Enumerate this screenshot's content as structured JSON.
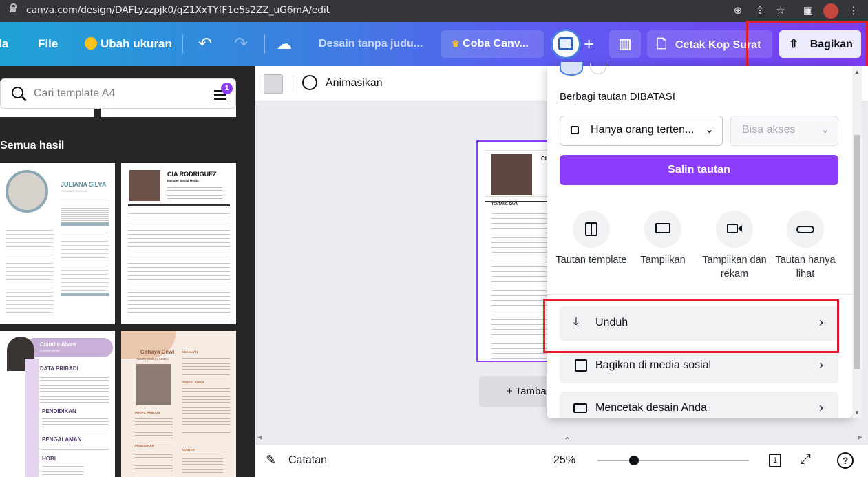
{
  "browser": {
    "url": "canva.com/design/DAFLyzzpjk0/qZ1XxTYfF1e5s2ZZ_uG6mA/edit"
  },
  "topbar": {
    "home_partial": "la",
    "file": "File",
    "resize": "Ubah ukuran",
    "doc_title": "Desain tanpa judu...",
    "try_canva": "Coba Canv...",
    "print_letterhead": "Cetak Kop Surat",
    "share": "Bagikan"
  },
  "sidebar": {
    "search_placeholder": "Cari template A4",
    "filter_badge": "1",
    "all_results": "Semua hasil",
    "templates": [
      {
        "name": "JULIANA SILVA",
        "subtitle": "DESAINER PRODUK"
      },
      {
        "name": "CIA RODRIGUEZ",
        "subtitle": "Manajer Sosial Media"
      },
      {
        "name": "Claudia Alves",
        "subtitle": "Content Writer"
      },
      {
        "name": "Cahaya Dewi",
        "subtitle": "ADMIN SOSIAL MEDIA"
      }
    ],
    "t3_sections": [
      "DATA PRIBADI",
      "PENDIDIKAN",
      "PENGALAMAN",
      "HOBI"
    ],
    "t4_sections": [
      "KEAHLIAN",
      "PENGALAMAN",
      "PROFIL PRIBADI",
      "PENDIDIKAN",
      "KONTAK"
    ]
  },
  "editor": {
    "animate": "Animasikan",
    "add_page": "+ Tamba",
    "notes": "Catatan",
    "zoom": "25%",
    "page_count": "1",
    "help": "?",
    "resume_section": "TENTANG SAYA"
  },
  "share_panel": {
    "title": "Berbagi tautan DIBATASI",
    "access_select": "Hanya orang terten...",
    "permission_select": "Bisa akses",
    "copy_link": "Salin tautan",
    "options": [
      {
        "label": "Tautan template",
        "icon": "template-link-icon"
      },
      {
        "label": "Tampilkan",
        "icon": "present-icon"
      },
      {
        "label": "Tampilkan dan rekam",
        "icon": "record-icon"
      },
      {
        "label": "Tautan hanya lihat",
        "icon": "link-icon"
      }
    ],
    "rows": [
      {
        "label": "Unduh",
        "icon": "download-icon"
      },
      {
        "label": "Bagikan di media sosial",
        "icon": "social-icon"
      },
      {
        "label": "Mencetak desain Anda",
        "icon": "truck-icon"
      }
    ]
  },
  "colors": {
    "accent_purple": "#8b3dff",
    "highlight_red": "#e31d2b"
  }
}
